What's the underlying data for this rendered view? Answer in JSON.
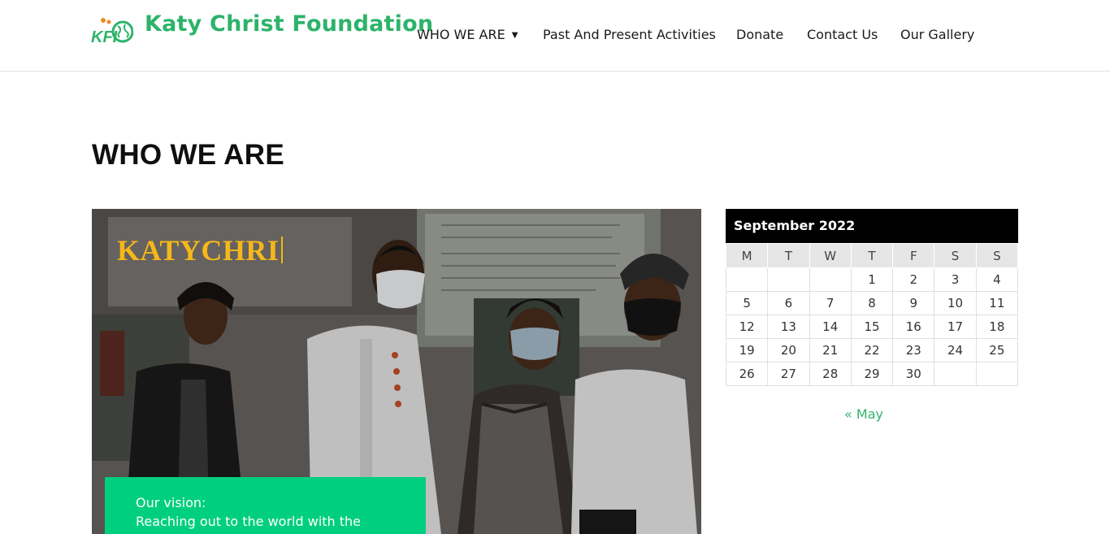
{
  "header": {
    "logo_text": "KFI",
    "brand_name": "Katy Christ Foundation",
    "nav": [
      {
        "label": "WHO WE ARE",
        "has_dropdown": true
      },
      {
        "label": "Past And Present Activities",
        "has_dropdown": false
      },
      {
        "label": "Donate",
        "has_dropdown": false
      },
      {
        "label": "Contact Us",
        "has_dropdown": false
      },
      {
        "label": "Our Gallery",
        "has_dropdown": false
      }
    ]
  },
  "page": {
    "title": "WHO WE ARE"
  },
  "hero": {
    "typed_text": "KATYCHRI",
    "vision_label": "Our vision:",
    "vision_text": "Reaching out to the world with the"
  },
  "calendar": {
    "caption": "September 2022",
    "weekdays": [
      "M",
      "T",
      "W",
      "T",
      "F",
      "S",
      "S"
    ],
    "weeks": [
      [
        "",
        "",
        "",
        "1",
        "2",
        "3",
        "4"
      ],
      [
        "5",
        "6",
        "7",
        "8",
        "9",
        "10",
        "11"
      ],
      [
        "12",
        "13",
        "14",
        "15",
        "16",
        "17",
        "18"
      ],
      [
        "19",
        "20",
        "21",
        "22",
        "23",
        "24",
        "25"
      ],
      [
        "26",
        "27",
        "28",
        "29",
        "30",
        "",
        ""
      ]
    ],
    "prev_link": "« May"
  },
  "colors": {
    "brand_green": "#2db36a",
    "vision_green": "#00cf7f",
    "typed_yellow": "#f5b71a",
    "calendar_header": "#000000"
  },
  "icons": {
    "dropdown": "caret-down-icon",
    "logo": "globe-logo-icon"
  }
}
